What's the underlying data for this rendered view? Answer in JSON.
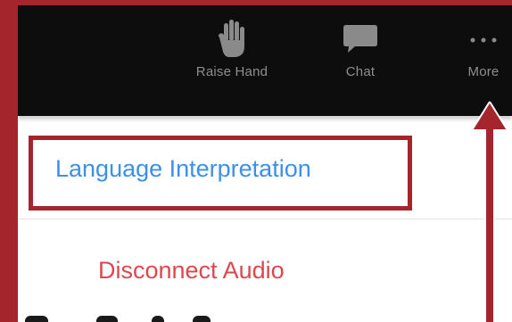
{
  "toolbar": {
    "raise_hand_label": "Raise Hand",
    "chat_label": "Chat",
    "more_label": "More",
    "icons": {
      "raise_hand": "hand-icon",
      "chat": "chat-bubble-icon",
      "more": "more-dots-icon"
    }
  },
  "menu": {
    "language_interpretation": "Language Interpretation",
    "disconnect_audio": "Disconnect Audio"
  },
  "colors": {
    "frame_red": "#a4262c",
    "toolbar_bg": "#0d0d0d",
    "link_blue": "#3d8fe8",
    "danger_red": "#e0474c",
    "toolbar_text": "#8e8e8e"
  }
}
